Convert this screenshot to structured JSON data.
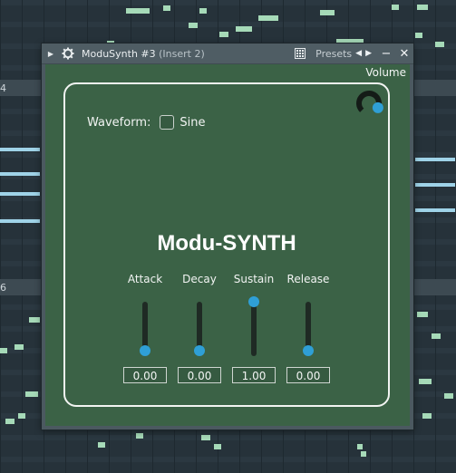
{
  "window": {
    "title": "ModuSynth #3",
    "insert": "(Insert 2)",
    "presets_label": "Presets",
    "minimize_glyph": "−",
    "close_glyph": "✕"
  },
  "background": {
    "bar_labels": [
      "4",
      "6"
    ]
  },
  "plugin": {
    "volume_label": "Volume",
    "volume_value": 0.93,
    "waveform_label": "Waveform:",
    "waveform_option": "Sine",
    "waveform_checked": false,
    "title": "Modu-SYNTH",
    "sliders": [
      {
        "label": "Attack",
        "value": 0.0,
        "display": "0.00"
      },
      {
        "label": "Decay",
        "value": 0.0,
        "display": "0.00"
      },
      {
        "label": "Sustain",
        "value": 1.0,
        "display": "1.00"
      },
      {
        "label": "Release",
        "value": 0.0,
        "display": "0.00"
      }
    ]
  },
  "colors": {
    "accent": "#2f9fd6",
    "panel_bg": "#3b6246",
    "note": "#a6dab8",
    "note_blue": "#9fd3e8"
  },
  "icons": {
    "gear": "gear-icon",
    "grid": "grid-icon",
    "prev": "chevron-left-icon",
    "next": "chevron-right-icon"
  }
}
